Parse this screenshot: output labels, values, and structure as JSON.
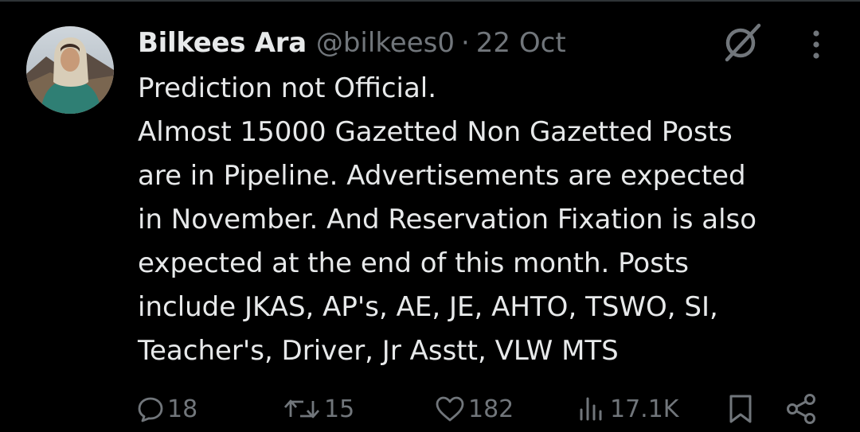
{
  "tweet": {
    "author_name": "Bilkees Ara",
    "handle": "@bilkees0",
    "separator": "·",
    "date": "22 Oct",
    "lines": [
      "Prediction not Official.",
      "Almost 15000 Gazetted Non Gazetted Posts",
      "are in Pipeline. Advertisements are expected",
      "in November. And Reservation Fixation is also",
      "expected at the end of this month. Posts",
      "include JKAS, AP's, AE, JE, AHTO, TSWO, SI,",
      "Teacher's, Driver, Jr Asstt, VLW MTS"
    ]
  },
  "actions": {
    "replies": "18",
    "reposts": "15",
    "likes": "182",
    "views": "17.1K"
  },
  "icons": {
    "grok": "grok-icon",
    "more": "more-icon",
    "reply": "reply-icon",
    "repost": "repost-icon",
    "like": "heart-icon",
    "views": "views-icon",
    "bookmark": "bookmark-icon",
    "share": "share-icon"
  },
  "colors": {
    "background": "#000000",
    "text": "#e7e9ea",
    "muted": "#71767b"
  }
}
